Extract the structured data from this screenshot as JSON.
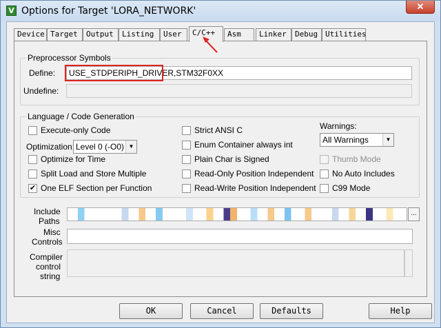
{
  "window": {
    "title": "Options for Target 'LORA_NETWORK'",
    "app_icon": "keil-uvision-icon",
    "close_label": "✕"
  },
  "tabs": [
    "Device",
    "Target",
    "Output",
    "Listing",
    "User",
    "C/C++",
    "Asm",
    "Linker",
    "Debug",
    "Utilities"
  ],
  "active_tab": "C/C++",
  "preprocessor": {
    "legend": "Preprocessor Symbols",
    "define_label": "Define:",
    "define_value": "USE_STDPERIPH_DRIVER,STM32F0XX",
    "undefine_label": "Undefine:",
    "undefine_value": ""
  },
  "language": {
    "legend": "Language / Code Generation",
    "execute_only": {
      "label": "Execute-only Code",
      "checked": false
    },
    "optimization_label": "Optimization:",
    "optimization_value": "Level 0 (-O0)",
    "optimize_time": {
      "label": "Optimize for Time",
      "checked": false
    },
    "split_load": {
      "label": "Split Load and Store Multiple",
      "checked": false
    },
    "one_elf": {
      "label": "One ELF Section per Function",
      "checked": true
    },
    "strict_ansi": {
      "label": "Strict ANSI C",
      "checked": false
    },
    "enum_container": {
      "label": "Enum Container always int",
      "checked": false
    },
    "plain_char": {
      "label": "Plain Char is Signed",
      "checked": false
    },
    "ro_pos_indep": {
      "label": "Read-Only Position Independent",
      "checked": false
    },
    "rw_pos_indep": {
      "label": "Read-Write Position Independent",
      "checked": false
    },
    "warnings_label": "Warnings:",
    "warnings_value": "All Warnings",
    "thumb_mode": {
      "label": "Thumb Mode",
      "checked": false,
      "disabled": true
    },
    "no_auto_includes": {
      "label": "No Auto Includes",
      "checked": false
    },
    "c99_mode": {
      "label": "C99 Mode",
      "checked": false
    }
  },
  "include_paths": {
    "label_line1": "Include",
    "label_line2": "Paths",
    "browse": "..."
  },
  "misc_controls": {
    "label_line1": "Misc",
    "label_line2": "Controls",
    "value": ""
  },
  "compiler_string": {
    "label_line1": "Compiler",
    "label_line2": "control",
    "label_line3": "string"
  },
  "buttons": {
    "ok": "OK",
    "cancel": "Cancel",
    "defaults": "Defaults",
    "help": "Help"
  },
  "colors": {
    "highlight": "#e0251f",
    "window_frame": "#cfe0f1",
    "close_button": "#c7412c"
  }
}
